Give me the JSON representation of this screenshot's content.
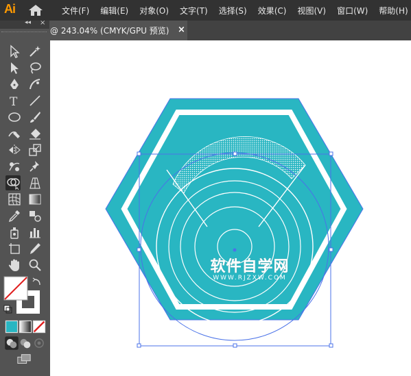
{
  "app": {
    "logo": "Ai"
  },
  "menu": [
    "文件(F)",
    "编辑(E)",
    "对象(O)",
    "文字(T)",
    "选择(S)",
    "效果(C)",
    "视图(V)",
    "窗口(W)",
    "帮助(H)"
  ],
  "document_tab": {
    "label": "@ 243.04% (CMYK/GPU 预览)",
    "close": "×"
  },
  "toolbar": {
    "collapse": "◂◂",
    "close": "×"
  },
  "artwork": {
    "hex_fill": "#29b6c2",
    "inner_stroke": "#ffffff",
    "selection_color": "#4a72e8"
  },
  "watermark": {
    "main": "软件自学网",
    "sub": "WWW.RJZXW.COM"
  }
}
